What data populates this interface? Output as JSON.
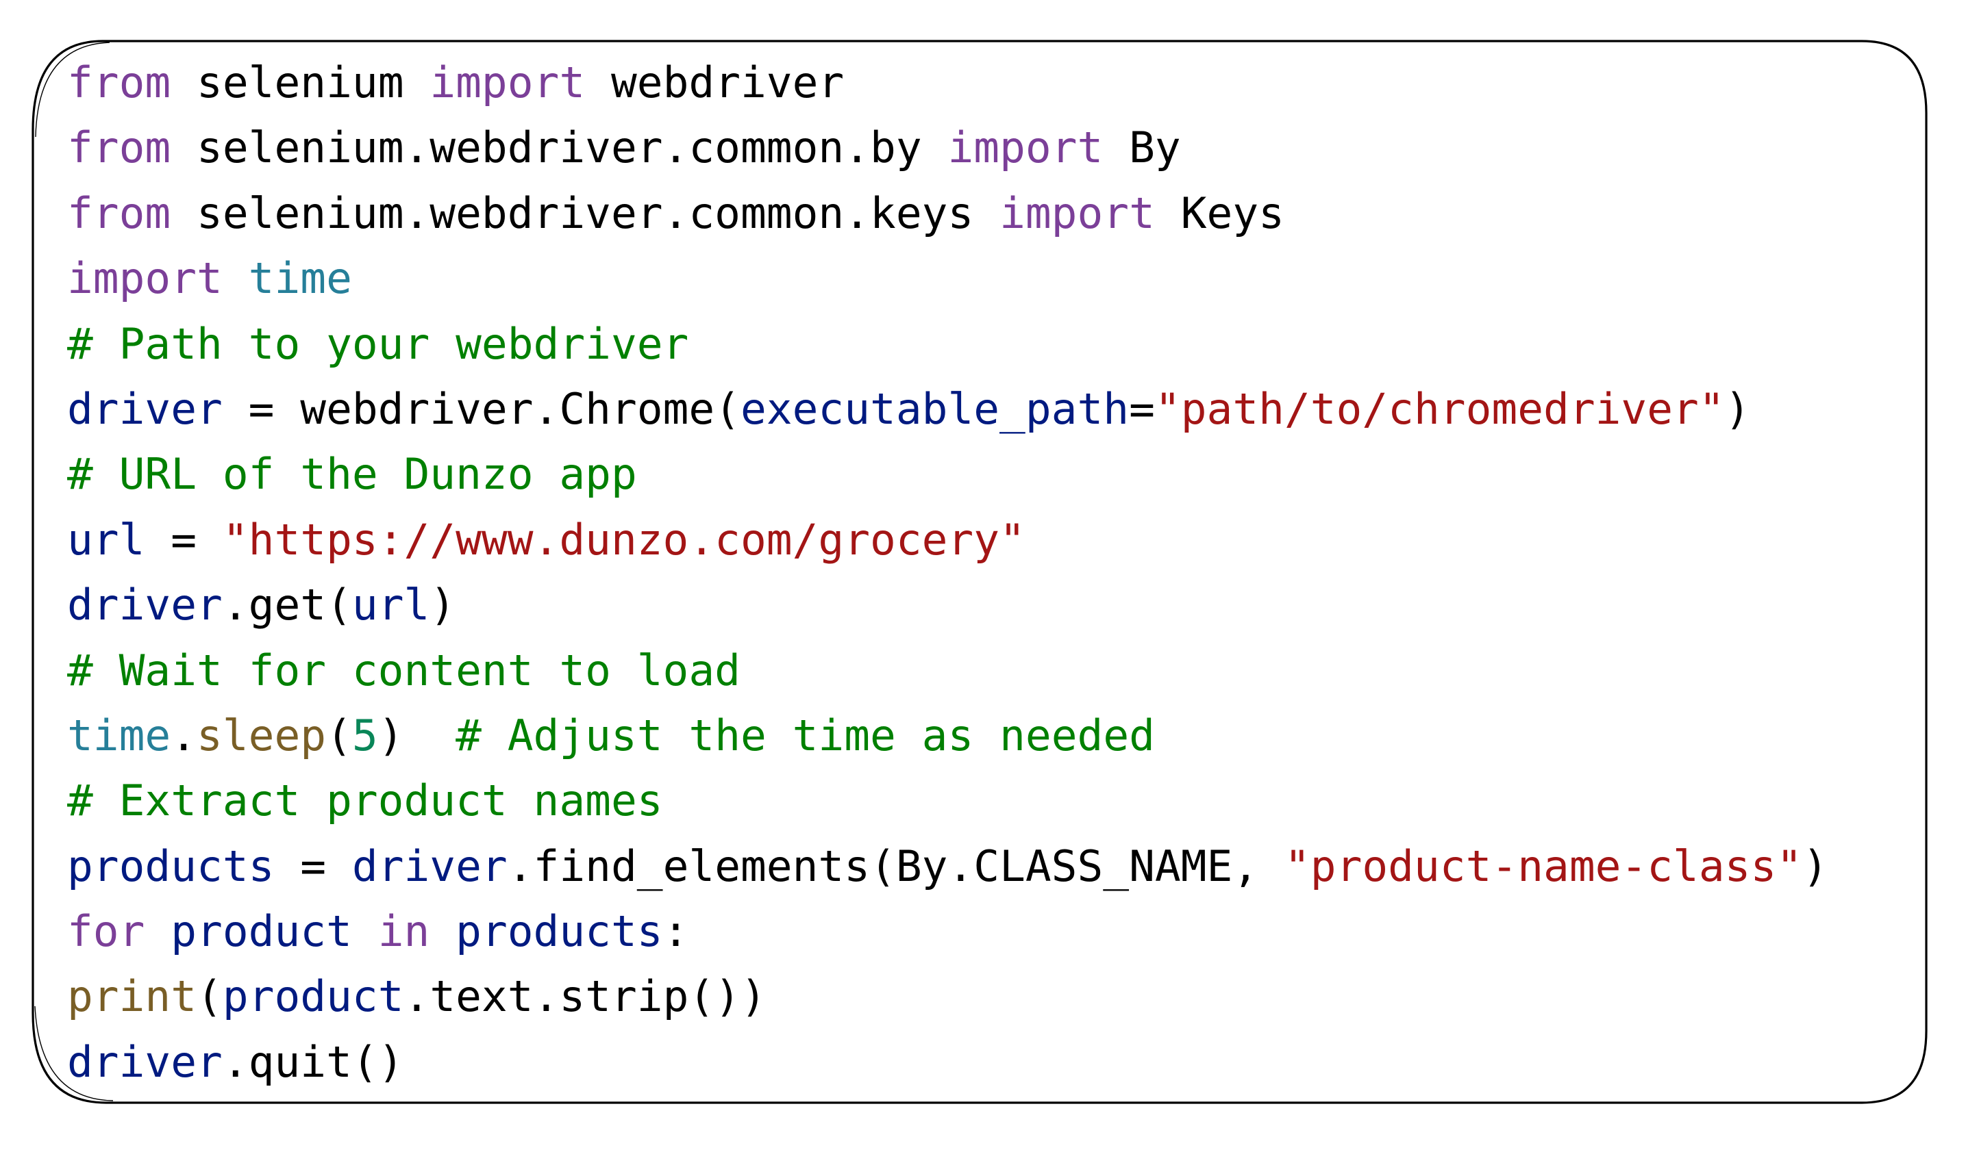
{
  "code_block": {
    "language": "python",
    "colors": {
      "keyword": "#7b3f98",
      "plain": "#000000",
      "variable": "#001a80",
      "module": "#267f99",
      "function": "#795e26",
      "string": "#a31515",
      "number": "#098658",
      "comment": "#008000",
      "border": "#000000",
      "background": "#ffffff"
    },
    "lines": [
      [
        [
          "keyword",
          "from"
        ],
        [
          "plain",
          " selenium "
        ],
        [
          "keyword",
          "import"
        ],
        [
          "plain",
          " webdriver"
        ]
      ],
      [
        [
          "keyword",
          "from"
        ],
        [
          "plain",
          " selenium.webdriver.common.by "
        ],
        [
          "keyword",
          "import"
        ],
        [
          "plain",
          " By"
        ]
      ],
      [
        [
          "keyword",
          "from"
        ],
        [
          "plain",
          " selenium.webdriver.common.keys "
        ],
        [
          "keyword",
          "import"
        ],
        [
          "plain",
          " Keys"
        ]
      ],
      [
        [
          "keyword",
          "import"
        ],
        [
          "plain",
          " "
        ],
        [
          "module",
          "time"
        ]
      ],
      [
        [
          "comment",
          "# Path to your webdriver"
        ]
      ],
      [
        [
          "variable",
          "driver"
        ],
        [
          "plain",
          " = webdriver.Chrome("
        ],
        [
          "variable",
          "executable_path"
        ],
        [
          "plain",
          "="
        ],
        [
          "string",
          "\"path/to/chromedriver\""
        ],
        [
          "plain",
          ")"
        ]
      ],
      [
        [
          "comment",
          "# URL of the Dunzo app"
        ]
      ],
      [
        [
          "variable",
          "url"
        ],
        [
          "plain",
          " = "
        ],
        [
          "string",
          "\"https://www.dunzo.com/grocery\""
        ]
      ],
      [
        [
          "variable",
          "driver"
        ],
        [
          "plain",
          ".get("
        ],
        [
          "variable",
          "url"
        ],
        [
          "plain",
          ")"
        ]
      ],
      [
        [
          "comment",
          "# Wait for content to load"
        ]
      ],
      [
        [
          "module",
          "time"
        ],
        [
          "plain",
          "."
        ],
        [
          "function",
          "sleep"
        ],
        [
          "plain",
          "("
        ],
        [
          "number",
          "5"
        ],
        [
          "plain",
          ")  "
        ],
        [
          "comment",
          "# Adjust the time as needed"
        ]
      ],
      [
        [
          "comment",
          "# Extract product names"
        ]
      ],
      [
        [
          "variable",
          "products"
        ],
        [
          "plain",
          " = "
        ],
        [
          "variable",
          "driver"
        ],
        [
          "plain",
          ".find_elements(By.CLASS_NAME, "
        ],
        [
          "string",
          "\"product-name-class\""
        ],
        [
          "plain",
          ")"
        ]
      ],
      [
        [
          "keyword",
          "for"
        ],
        [
          "plain",
          " "
        ],
        [
          "variable",
          "product"
        ],
        [
          "plain",
          " "
        ],
        [
          "keyword",
          "in"
        ],
        [
          "plain",
          " "
        ],
        [
          "variable",
          "products"
        ],
        [
          "plain",
          ":"
        ]
      ],
      [
        [
          "function",
          "print"
        ],
        [
          "plain",
          "("
        ],
        [
          "variable",
          "product"
        ],
        [
          "plain",
          ".text.strip())"
        ]
      ],
      [
        [
          "variable",
          "driver"
        ],
        [
          "plain",
          ".quit()"
        ]
      ]
    ]
  }
}
